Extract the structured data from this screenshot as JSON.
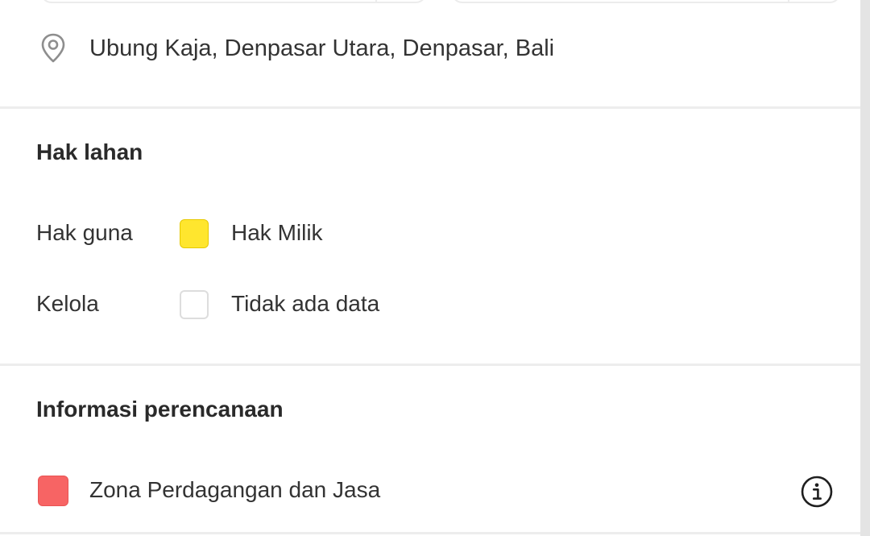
{
  "location": {
    "address": "Ubung Kaja, Denpasar Utara, Denpasar, Bali",
    "icon": "location-pin-icon"
  },
  "land_rights": {
    "title": "Hak lahan",
    "rows": [
      {
        "label": "Hak guna",
        "value": "Hak Milik",
        "color": "#FFE62E"
      },
      {
        "label": "Kelola",
        "value": "Tidak ada data",
        "color": "#FFFFFF"
      }
    ]
  },
  "planning": {
    "title": "Informasi perencanaan",
    "zone": {
      "label": "Zona Perdagangan dan Jasa",
      "color": "#F76464"
    },
    "info_icon": "info-icon"
  }
}
